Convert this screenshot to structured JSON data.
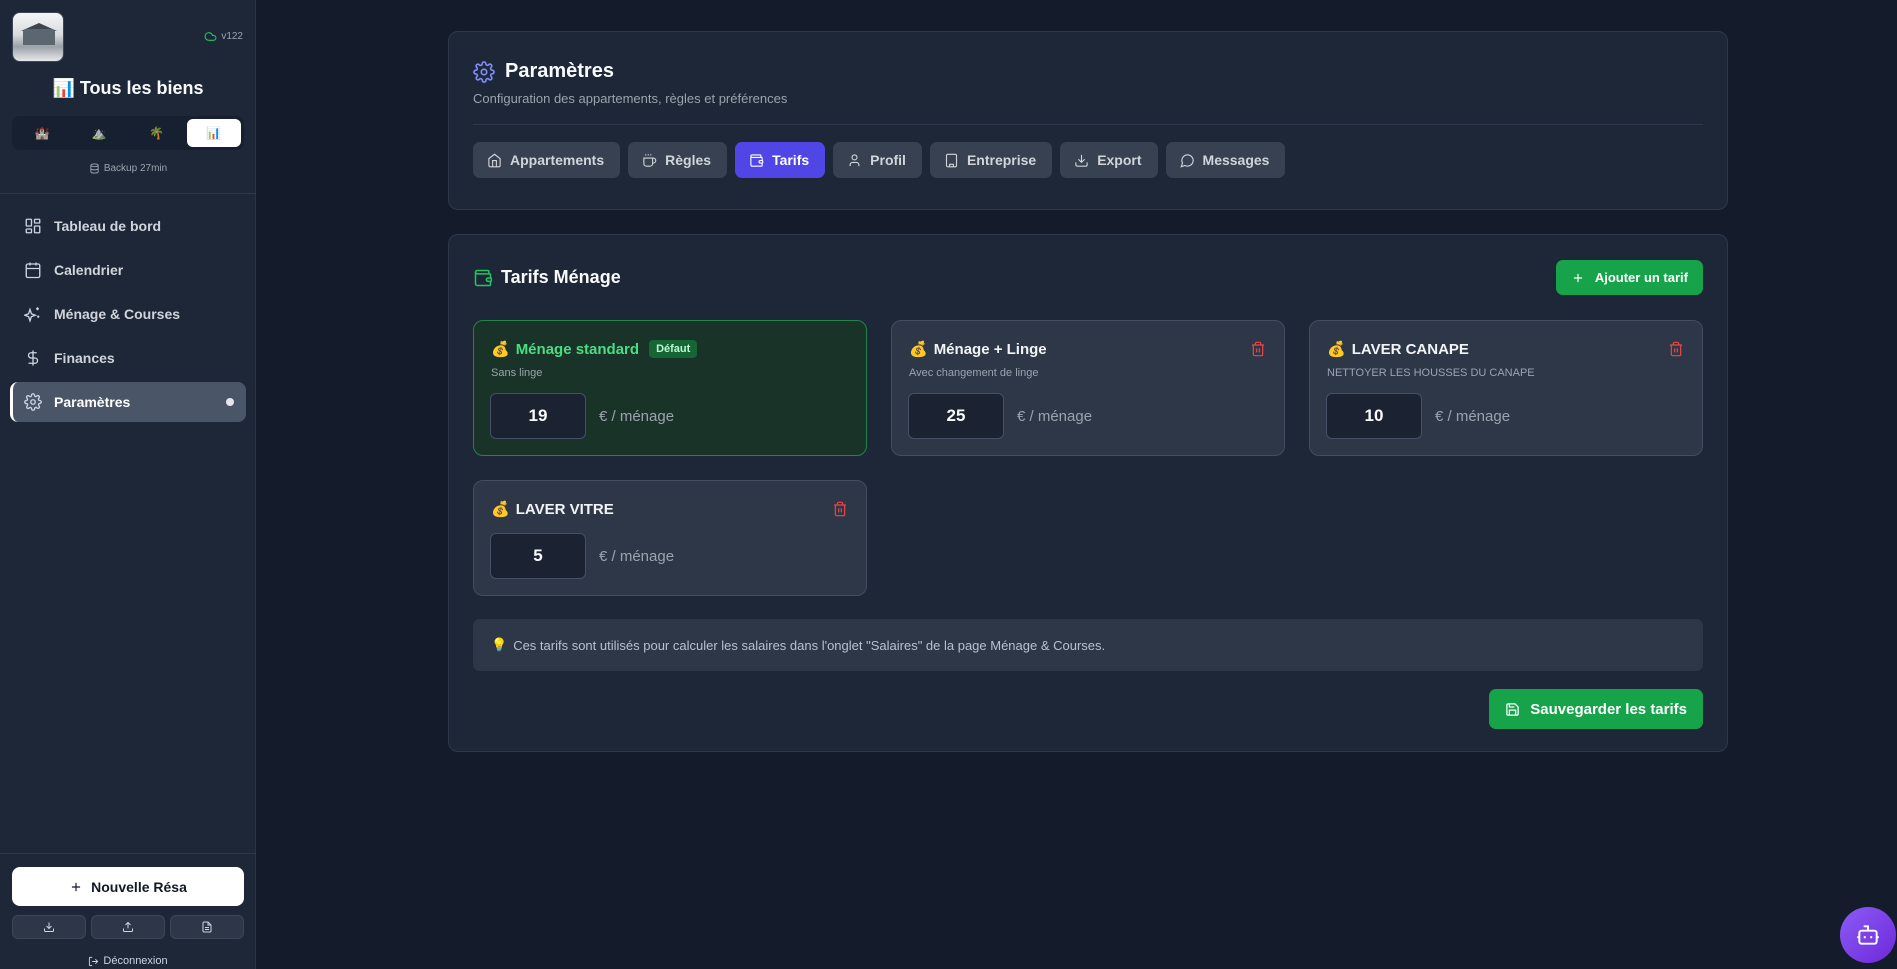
{
  "sidebar": {
    "version": "v122",
    "property_title": "📊 Tous les biens",
    "property_tabs": [
      {
        "label": "🏰",
        "active": false
      },
      {
        "label": "⛰️",
        "active": false
      },
      {
        "label": "🌴",
        "active": false
      },
      {
        "label": "📊",
        "active": true
      }
    ],
    "backup": "Backup 27min",
    "nav": [
      {
        "label": "Tableau de bord",
        "icon": "grid-icon",
        "active": false
      },
      {
        "label": "Calendrier",
        "icon": "calendar-icon",
        "active": false
      },
      {
        "label": "Ménage & Courses",
        "icon": "sparkles-icon",
        "active": false
      },
      {
        "label": "Finances",
        "icon": "dollar-icon",
        "active": false
      },
      {
        "label": "Paramètres",
        "icon": "gear-icon",
        "active": true
      }
    ],
    "new_resa": "Nouvelle Résa",
    "mini_buttons": [
      "download-icon",
      "upload-icon",
      "file-icon"
    ],
    "logout": "Déconnexion"
  },
  "header": {
    "title": "Paramètres",
    "subtitle": "Configuration des appartements, règles et préférences",
    "tabs": [
      {
        "label": "Appartements",
        "icon": "home-icon",
        "active": false
      },
      {
        "label": "Règles",
        "icon": "coffee-icon",
        "active": false
      },
      {
        "label": "Tarifs",
        "icon": "wallet-icon",
        "active": true
      },
      {
        "label": "Profil",
        "icon": "user-icon",
        "active": false
      },
      {
        "label": "Entreprise",
        "icon": "building-icon",
        "active": false
      },
      {
        "label": "Export",
        "icon": "download-icon",
        "active": false
      },
      {
        "label": "Messages",
        "icon": "message-icon",
        "active": false
      }
    ]
  },
  "tarifs": {
    "title": "Tarifs Ménage",
    "add_label": "Ajouter un tarif",
    "unit_label": "€ / ménage",
    "default_badge": "Défaut",
    "cards": [
      {
        "emoji": "💰",
        "name": "Ménage standard",
        "subtitle": "Sans linge",
        "price": "19",
        "default": true
      },
      {
        "emoji": "💰",
        "name": "Ménage + Linge",
        "subtitle": "Avec changement de linge",
        "price": "25",
        "default": false
      },
      {
        "emoji": "💰",
        "name": "LAVER CANAPE",
        "subtitle": "NETTOYER LES HOUSSES DU CANAPE",
        "price": "10",
        "default": false
      },
      {
        "emoji": "💰",
        "name": "LAVER VITRE",
        "subtitle": "",
        "price": "5",
        "default": false
      }
    ],
    "info_emoji": "💡",
    "info": "Ces tarifs sont utilisés pour calculer les salaires dans l'onglet \"Salaires\" de la page Ménage & Courses.",
    "save_label": "Sauvegarder les tarifs"
  },
  "colors": {
    "background": "#141b2b",
    "panel": "#1d2737",
    "accent": "#4f46e5",
    "success": "#16a34a",
    "danger": "#ef4444"
  }
}
